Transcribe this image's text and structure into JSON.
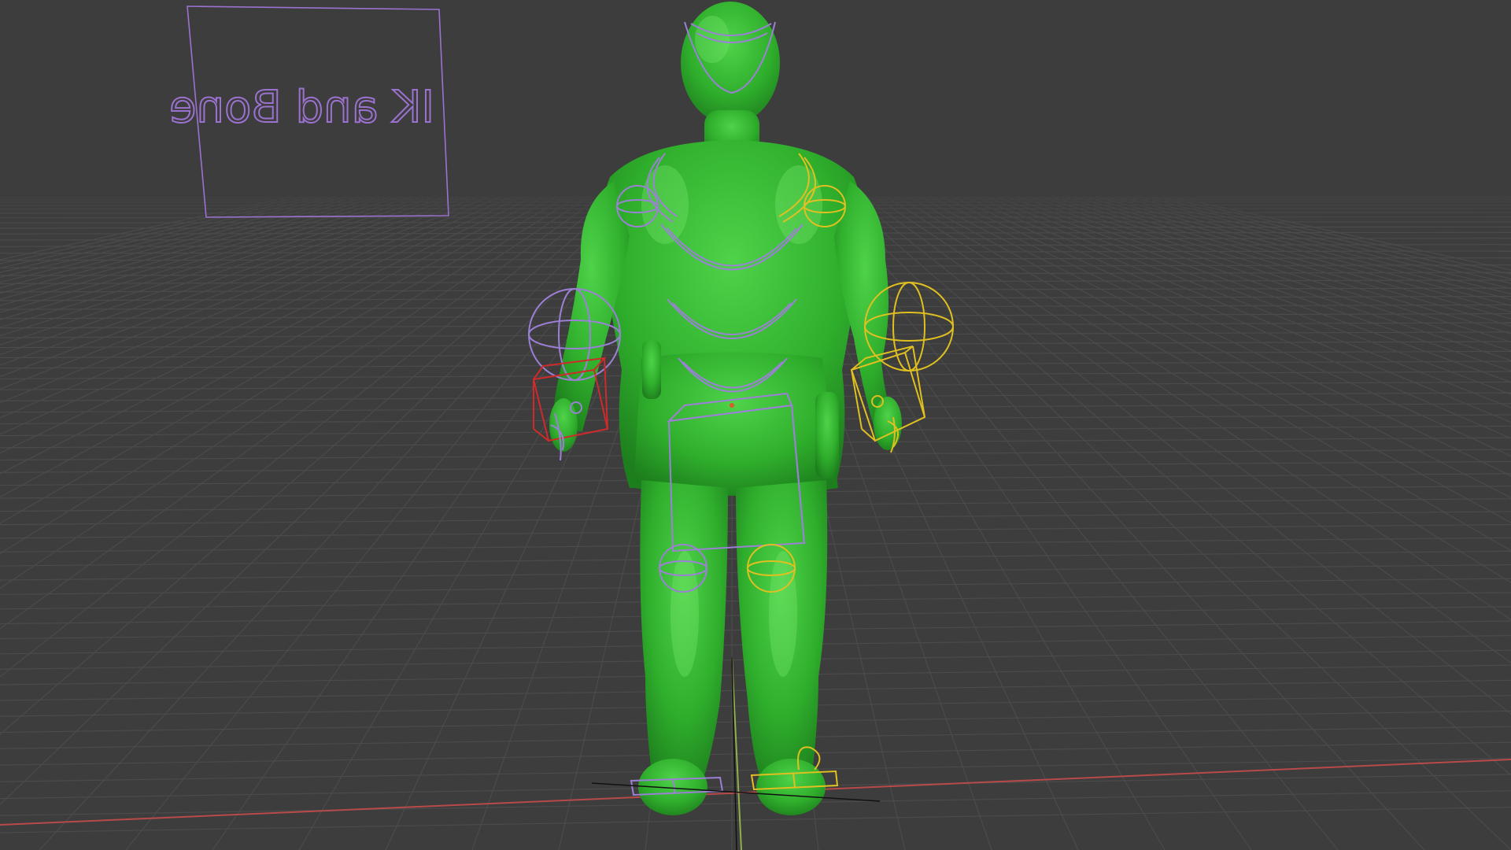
{
  "viewport": {
    "background": "#3d3d3d",
    "grid_color": "#4a4a4a",
    "x_axis_color": "#b84a4a",
    "y_axis_color": "#8fb04a"
  },
  "text_object": {
    "text": "IK and Bone",
    "color": "#9b72cf",
    "mirrored": true
  },
  "armature": {
    "left_color": "#9b80d6",
    "right_color": "#e0c020",
    "selected_color": "#d02a2a"
  },
  "figure": {
    "color": "#33b533"
  }
}
